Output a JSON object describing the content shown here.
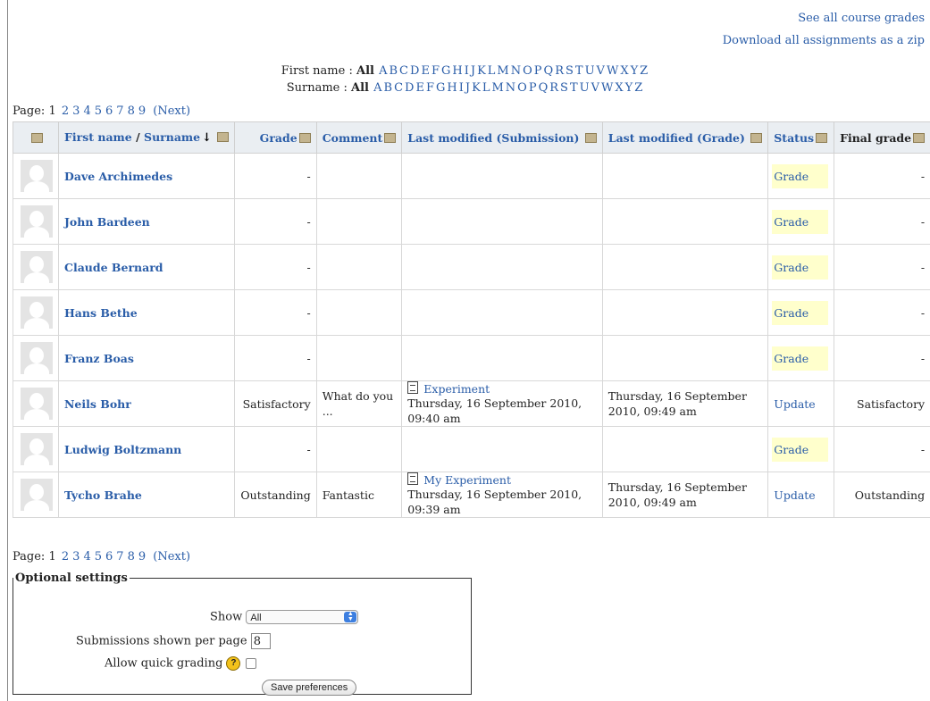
{
  "top_links": {
    "course_grades": "See all course grades",
    "download_zip": "Download all assignments as a zip"
  },
  "filters": {
    "firstname_label": "First name :",
    "surname_label": "Surname :",
    "all": "All",
    "letters": [
      "A",
      "B",
      "C",
      "D",
      "E",
      "F",
      "G",
      "H",
      "I",
      "J",
      "K",
      "L",
      "M",
      "N",
      "O",
      "P",
      "Q",
      "R",
      "S",
      "T",
      "U",
      "V",
      "W",
      "X",
      "Y",
      "Z"
    ]
  },
  "paging": {
    "label": "Page:",
    "current": "1",
    "pages": [
      "2",
      "3",
      "4",
      "5",
      "6",
      "7",
      "8",
      "9"
    ],
    "next": "(Next)"
  },
  "table": {
    "headers": {
      "first_name": "First name",
      "separator": "/",
      "surname": "Surname",
      "sort_arrow": "↓",
      "grade": "Grade",
      "comment": "Comment",
      "last_modified_submission": "Last modified (Submission)",
      "last_modified_grade": "Last modified (Grade)",
      "status": "Status",
      "final_grade": "Final grade"
    },
    "rows": [
      {
        "name": "Dave Archimedes",
        "grade": "-",
        "comment": "",
        "sub_file": "",
        "sub_date": "",
        "grade_date": "",
        "status": "Grade",
        "final": "-"
      },
      {
        "name": "John Bardeen",
        "grade": "-",
        "comment": "",
        "sub_file": "",
        "sub_date": "",
        "grade_date": "",
        "status": "Grade",
        "final": "-"
      },
      {
        "name": "Claude Bernard",
        "grade": "-",
        "comment": "",
        "sub_file": "",
        "sub_date": "",
        "grade_date": "",
        "status": "Grade",
        "final": "-"
      },
      {
        "name": "Hans Bethe",
        "grade": "-",
        "comment": "",
        "sub_file": "",
        "sub_date": "",
        "grade_date": "",
        "status": "Grade",
        "final": "-"
      },
      {
        "name": "Franz Boas",
        "grade": "-",
        "comment": "",
        "sub_file": "",
        "sub_date": "",
        "grade_date": "",
        "status": "Grade",
        "final": "-"
      },
      {
        "name": "Neils Bohr",
        "grade": "Satisfactory",
        "comment": "What do you ...",
        "sub_file": "Experiment",
        "sub_date": "Thursday, 16 September 2010, 09:40 am",
        "grade_date": "Thursday, 16 September 2010, 09:49 am",
        "status": "Update",
        "final": "Satisfactory"
      },
      {
        "name": "Ludwig Boltzmann",
        "grade": "-",
        "comment": "",
        "sub_file": "",
        "sub_date": "",
        "grade_date": "",
        "status": "Grade",
        "final": "-"
      },
      {
        "name": "Tycho Brahe",
        "grade": "Outstanding",
        "comment": "Fantastic",
        "sub_file": "My Experiment",
        "sub_date": "Thursday, 16 September 2010, 09:39 am",
        "grade_date": "Thursday, 16 September 2010, 09:49 am",
        "status": "Update",
        "final": "Outstanding"
      }
    ]
  },
  "options": {
    "legend": "Optional settings",
    "show_label": "Show",
    "show_value": "All",
    "per_page_label": "Submissions shown per page",
    "per_page_value": "8",
    "quick_grading_label": "Allow quick grading",
    "help_glyph": "?",
    "save_button": "Save preferences"
  },
  "colors": {
    "link": "#2a5da8",
    "grade_highlight": "#ffffcc",
    "header_bg": "#eaeef2"
  }
}
